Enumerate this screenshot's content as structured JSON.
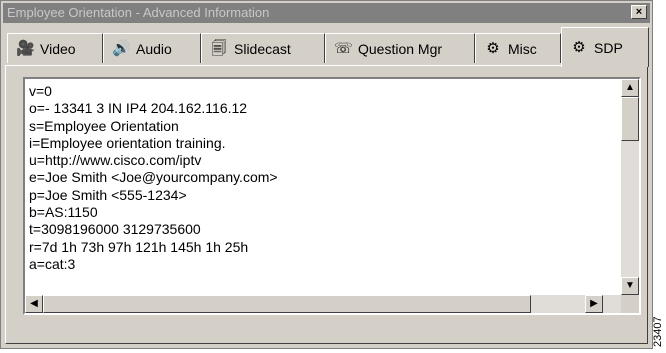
{
  "window": {
    "title": "Employee Orientation - Advanced Information",
    "close_glyph": "×"
  },
  "tabs": [
    {
      "label": "Video",
      "icon": "video-icon",
      "glyph": "🎥"
    },
    {
      "label": "Audio",
      "icon": "speaker-icon",
      "glyph": "🔊"
    },
    {
      "label": "Slidecast",
      "icon": "slidecast-icon",
      "glyph": "🗐"
    },
    {
      "label": "Question Mgr",
      "icon": "question-manager-icon",
      "glyph": "☏"
    },
    {
      "label": "Misc",
      "icon": "misc-icon",
      "glyph": "⚙"
    },
    {
      "label": "SDP",
      "icon": "sdp-icon",
      "glyph": "⚙",
      "active": true
    }
  ],
  "sdp_lines": [
    "v=0",
    "o=- 13341 3 IN IP4 204.162.116.12",
    "s=Employee Orientation",
    "i=Employee orientation training.",
    "u=http://www.cisco.com/iptv",
    "e=Joe Smith <Joe@yourcompany.com>",
    "p=Joe Smith <555-1234>",
    "b=AS:1150",
    "t=3098196000 3129735600",
    "r=7d 1h 73h 97h 121h 145h 1h 25h",
    "a=cat:3"
  ],
  "scroll": {
    "up_glyph": "▲",
    "down_glyph": "▼",
    "left_glyph": "◀",
    "right_glyph": "▶"
  },
  "figure_id": "23407"
}
